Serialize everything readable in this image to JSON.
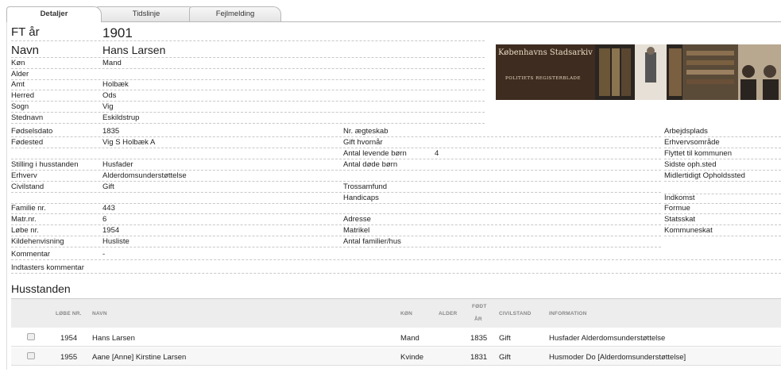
{
  "tabs": [
    {
      "label": "Detaljer"
    },
    {
      "label": "Tidslinje"
    },
    {
      "label": "Fejlmelding"
    }
  ],
  "header": {
    "ft_label": "FT år",
    "ft_value": "1901",
    "name_label": "Navn",
    "name_value": "Hans Larsen"
  },
  "top_fields": [
    {
      "label": "Køn",
      "value": "Mand"
    },
    {
      "label": "Alder",
      "value": ""
    },
    {
      "label": "Amt",
      "value": "Holbæk"
    },
    {
      "label": "Herred",
      "value": "Ods"
    },
    {
      "label": "Sogn",
      "value": "Vig"
    },
    {
      "label": "Stednavn",
      "value": "Eskildstrup"
    }
  ],
  "banner": {
    "title": "Københavns Stadsarkiv",
    "subtitle": "POLITIETS REGISTERBLADE"
  },
  "col1": [
    {
      "label": "Fødselsdato",
      "value": "1835"
    },
    {
      "label": "Fødested",
      "value": "Vig S Holbæk A"
    },
    {
      "label": "",
      "value": ""
    },
    {
      "label": "Stilling i husstanden",
      "value": "Husfader"
    },
    {
      "label": "Erhverv",
      "value": "Alderdomsunderstøttelse"
    },
    {
      "label": "Civilstand",
      "value": "Gift"
    },
    {
      "label": "",
      "value": ""
    },
    {
      "label": "Familie nr.",
      "value": "443"
    },
    {
      "label": "Matr.nr.",
      "value": "6"
    },
    {
      "label": "Løbe nr.",
      "value": "1954"
    },
    {
      "label": "Kildehenvisning",
      "value": "Husliste"
    },
    {
      "label": "Kommentar",
      "value": "-"
    },
    {
      "label": "Indtasters kommentar",
      "value": ""
    }
  ],
  "col2": [
    {
      "label": "Nr. ægteskab",
      "value": ""
    },
    {
      "label": "Gift hvornår",
      "value": ""
    },
    {
      "label": "Antal levende børn",
      "value": "4"
    },
    {
      "label": "Antal døde børn",
      "value": ""
    },
    {
      "label": "",
      "value": ""
    },
    {
      "label": "Trossamfund",
      "value": ""
    },
    {
      "label": "Handicaps",
      "value": ""
    },
    {
      "label": "",
      "value": ""
    },
    {
      "label": "Adresse",
      "value": ""
    },
    {
      "label": "Matrikel",
      "value": ""
    },
    {
      "label": "Antal familier/hus",
      "value": ""
    }
  ],
  "col3": [
    {
      "label": "Arbejdsplads"
    },
    {
      "label": "Erhvervsområde"
    },
    {
      "label": "Flyttet til kommunen"
    },
    {
      "label": "Sidste oph.sted"
    },
    {
      "label": "Midlertidigt Opholdssted"
    },
    {
      "label": ""
    },
    {
      "label": "Indkomst"
    },
    {
      "label": "Formue"
    },
    {
      "label": "Statsskat"
    },
    {
      "label": "Kommuneskat"
    }
  ],
  "household": {
    "title": "Husstanden",
    "headers": {
      "lobe": "LØBE NR.",
      "navn": "NAVN",
      "kon": "KØN",
      "alder": "ALDER",
      "fodt1": "FØDT",
      "fodt2": "ÅR",
      "civil": "CIVILSTAND",
      "info": "INFORMATION"
    },
    "rows": [
      {
        "lobe": "1954",
        "navn": "Hans Larsen",
        "kon": "Mand",
        "alder": "",
        "fodt": "1835",
        "civil": "Gift",
        "info": "Husfader Alderdomsunderstøttelse"
      },
      {
        "lobe": "1955",
        "navn": "Aane [Anne] Kirstine Larsen",
        "kon": "Kvinde",
        "alder": "",
        "fodt": "1831",
        "civil": "Gift",
        "info": "Husmoder Do [Alderdomsunderstøttelse]"
      }
    ]
  }
}
